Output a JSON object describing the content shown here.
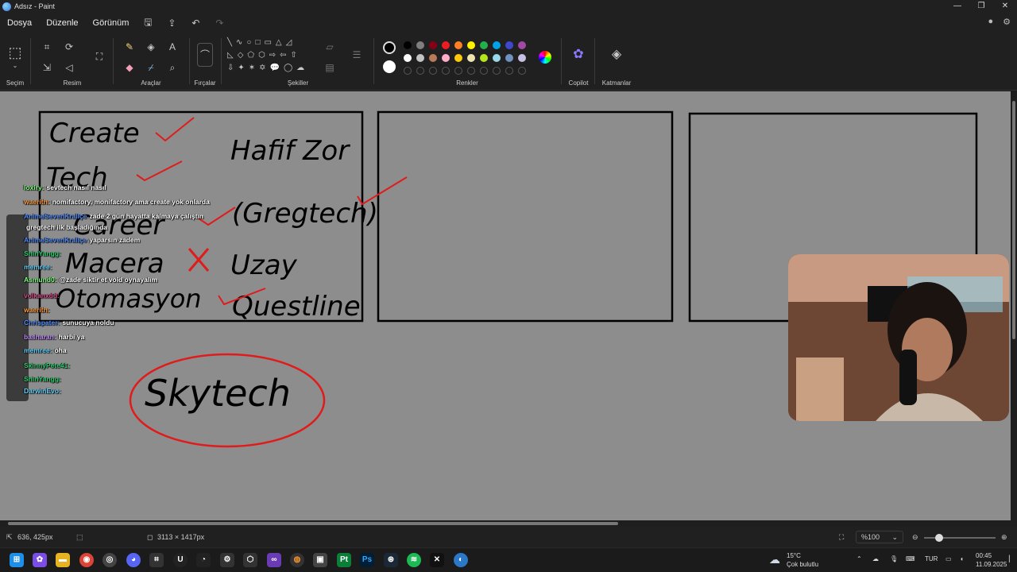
{
  "window": {
    "title": "Adsız - Paint"
  },
  "menu": {
    "items": [
      "Dosya",
      "Düzenle",
      "Görünüm"
    ]
  },
  "ribbon": {
    "groups": {
      "selection": "Seçim",
      "image": "Resim",
      "tools": "Araçlar",
      "brushes": "Fırçalar",
      "shapes": "Şekiller",
      "colors": "Renkler",
      "copilot": "Copilot",
      "layers": "Katmanlar"
    },
    "palette_row1": [
      "#000000",
      "#7f7f7f",
      "#880015",
      "#ed1c24",
      "#ff7f27",
      "#fff200",
      "#22b14c",
      "#00a2e8",
      "#3f48cc",
      "#a349a4"
    ],
    "palette_row2": [
      "#ffffff",
      "#c3c3c3",
      "#b97a57",
      "#ffaec9",
      "#ffc90e",
      "#efe4b0",
      "#b5e61d",
      "#99d9ea",
      "#7092be",
      "#c8bfe7"
    ]
  },
  "canvas": {
    "words": {
      "create": "Create",
      "tech": "Tech",
      "career": "Career",
      "macera": "Macera",
      "otomasyon": "Otomasyon",
      "hafif_zor": "Hafif Zor",
      "gregtech": "(Gregtech)",
      "uzay": "Uzay",
      "questline": "Questline",
      "skytech": "Skytech"
    }
  },
  "chat": {
    "messages": [
      {
        "user": "loxiry:",
        "text": "sevtech nasıl nasıl",
        "color": "#7cff7c"
      },
      {
        "user": "waerith:",
        "text": "nomifactory, monifactory ama create yok onlarda",
        "color": "#ff9a3c"
      },
      {
        "user": "AnimeSevenKraliçe",
        "text": "zade 2 gün hayatta kalmaya çalıştın",
        "color": "#4f8cff"
      },
      {
        "user": "",
        "text": "gregtech ilk başladığında",
        "color": "#ffffff"
      },
      {
        "user": "AnimeSevenKraliçe",
        "text": "yaparsın zadem",
        "color": "#4f8cff"
      },
      {
        "user": "ShinYangg:",
        "text": "",
        "color": "#2ecc71"
      },
      {
        "user": "memree:",
        "text": "",
        "color": "#5fd3ff"
      },
      {
        "user": "Asmund0:",
        "text": "@zade siktir et void oynayalım",
        "color": "#7cff7c"
      },
      {
        "user": "volkanxdd:",
        "text": "",
        "color": "#d94c8a"
      },
      {
        "user": "waerith:",
        "text": "",
        "color": "#ff9a3c"
      },
      {
        "user": "Chrispater:",
        "text": "sunucuya noldu",
        "color": "#4f8cff"
      },
      {
        "user": "basharan:",
        "text": "harbi ya",
        "color": "#c38cff"
      },
      {
        "user": "memree:",
        "text": "oha",
        "color": "#5fd3ff"
      },
      {
        "user": "SkinnyPete41:",
        "text": "",
        "color": "#2ecc71"
      },
      {
        "user": "ShinYangg:",
        "text": "",
        "color": "#2ecc71"
      },
      {
        "user": "DarwinEvo:",
        "text": "",
        "color": "#5fd3ff"
      }
    ]
  },
  "status": {
    "cursor": "636, 425px",
    "size": "3113 × 1417px",
    "zoom": "%100"
  },
  "taskbar": {
    "weather_temp": "15°C",
    "weather_desc": "Çok bulutlu",
    "lang": "TUR",
    "time": "00:45",
    "date": "11.09.2025"
  }
}
